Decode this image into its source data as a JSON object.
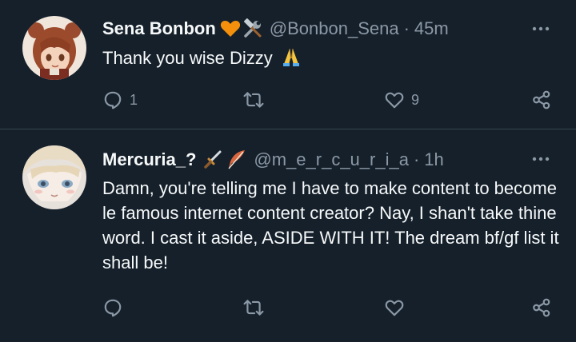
{
  "tweets": [
    {
      "display_name": "Sena Bonbon",
      "name_emojis": [
        "orange-heart-icon",
        "hammer-and-wrench-icon"
      ],
      "handle": "@Bonbon_Sena",
      "separator": "·",
      "time": "45m",
      "text": "Thank you wise Dizzy",
      "text_emoji": "folded-hands-icon",
      "reply_count": "1",
      "retweet_count": "",
      "like_count": "9"
    },
    {
      "display_name": "Mercuria_?",
      "name_emojis": [
        "dagger-icon",
        "feather-icon"
      ],
      "handle": "@m_e_r_c_u_r_i_a",
      "separator": "·",
      "time": "1h",
      "text": "Damn, you're telling me I have to make content to become le famous internet content creator? Nay, I shan't take thine word. I cast it aside, ASIDE WITH IT! The dream bf/gf list it shall be!",
      "reply_count": "",
      "retweet_count": "",
      "like_count": ""
    }
  ],
  "colors": {
    "background": "#15202b",
    "text_primary": "#f7f9f9",
    "text_secondary": "#8b98a5",
    "divider": "#38444d",
    "heart_emoji": "#f4900c"
  }
}
